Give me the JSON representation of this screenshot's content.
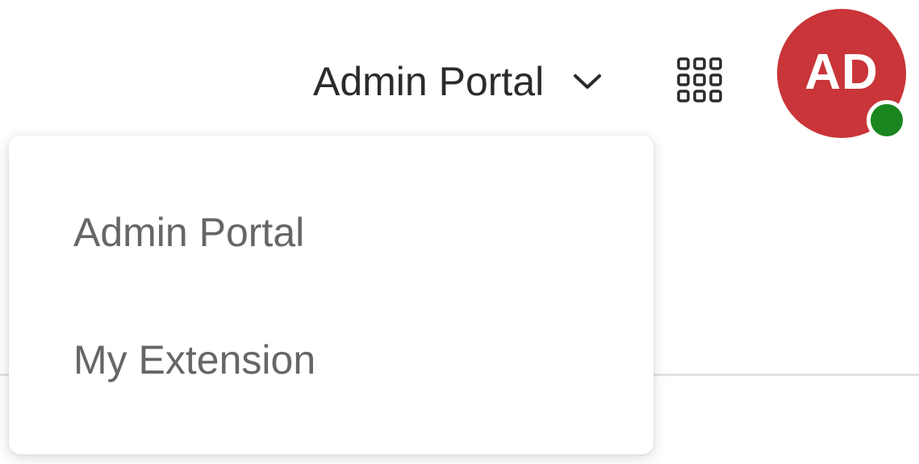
{
  "header": {
    "portal_label": "Admin Portal",
    "chevron_icon": "chevron-down-icon",
    "apps_icon": "apps-grid-icon",
    "avatar": {
      "initials": "AD",
      "color": "#c93538",
      "status_color": "#1b861f"
    }
  },
  "dropdown": {
    "items": [
      {
        "label": "Admin Portal"
      },
      {
        "label": "My Extension"
      }
    ]
  }
}
